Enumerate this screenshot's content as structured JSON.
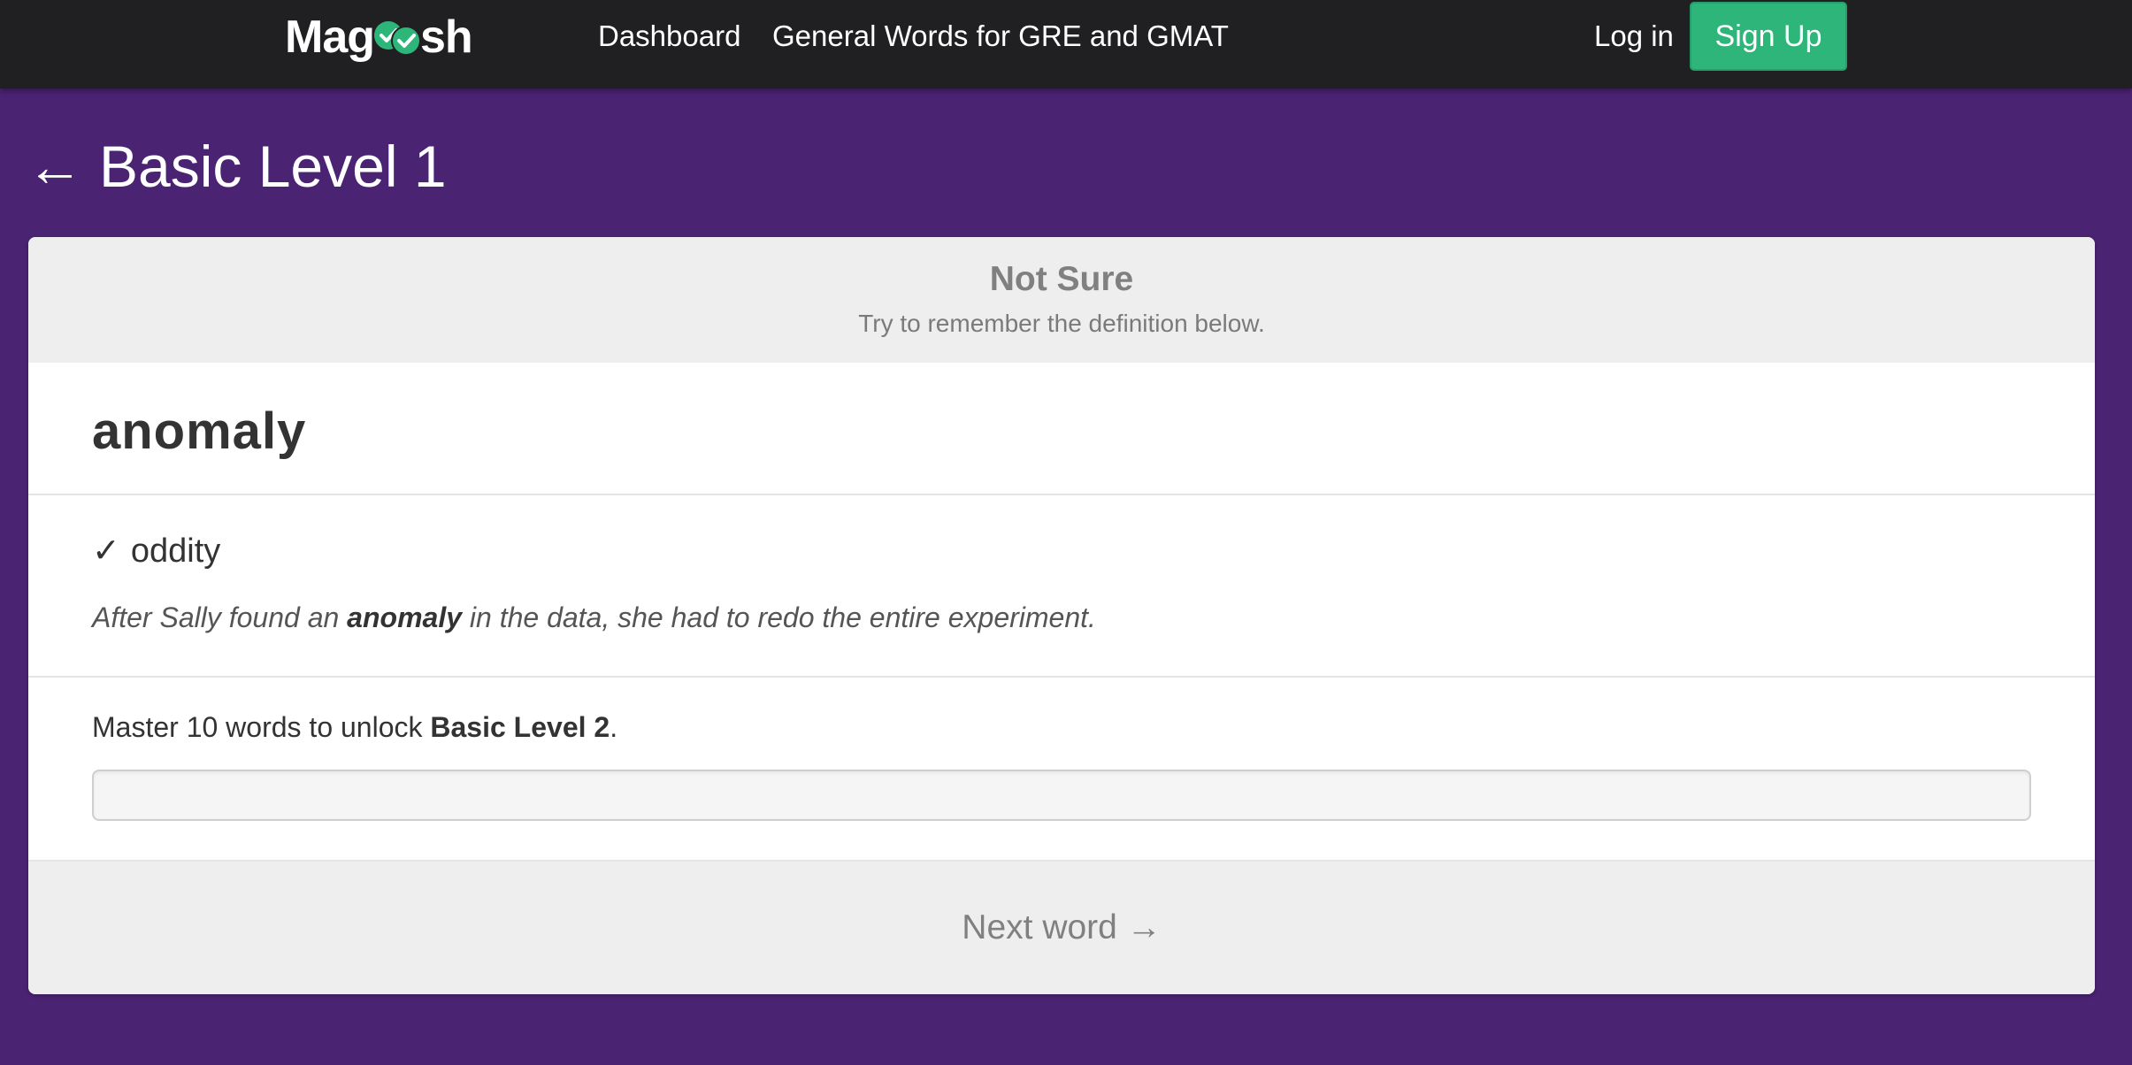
{
  "nav": {
    "logo_left": "Mag",
    "logo_right": "sh",
    "dashboard": "Dashboard",
    "general_words": "General Words for GRE and GMAT",
    "login": "Log in",
    "signup": "Sign Up"
  },
  "page": {
    "back_arrow": "←",
    "title": "Basic Level 1"
  },
  "status": {
    "title": "Not Sure",
    "subtitle": "Try to remember the definition below."
  },
  "card": {
    "word": "anomaly",
    "check_mark": "✓",
    "definition": "oddity",
    "example_before": "After Sally found an ",
    "example_word": "anomaly",
    "example_after": " in the data, she had to redo the entire experiment."
  },
  "progress": {
    "unlock_prefix": "Master 10 words to unlock ",
    "unlock_level": "Basic Level 2",
    "unlock_suffix": ".",
    "fraction": 0
  },
  "next": {
    "label": "Next word →"
  },
  "colors": {
    "nav_bg": "#202022",
    "page_bg": "#4b2373",
    "accent_green": "#2db57a"
  }
}
